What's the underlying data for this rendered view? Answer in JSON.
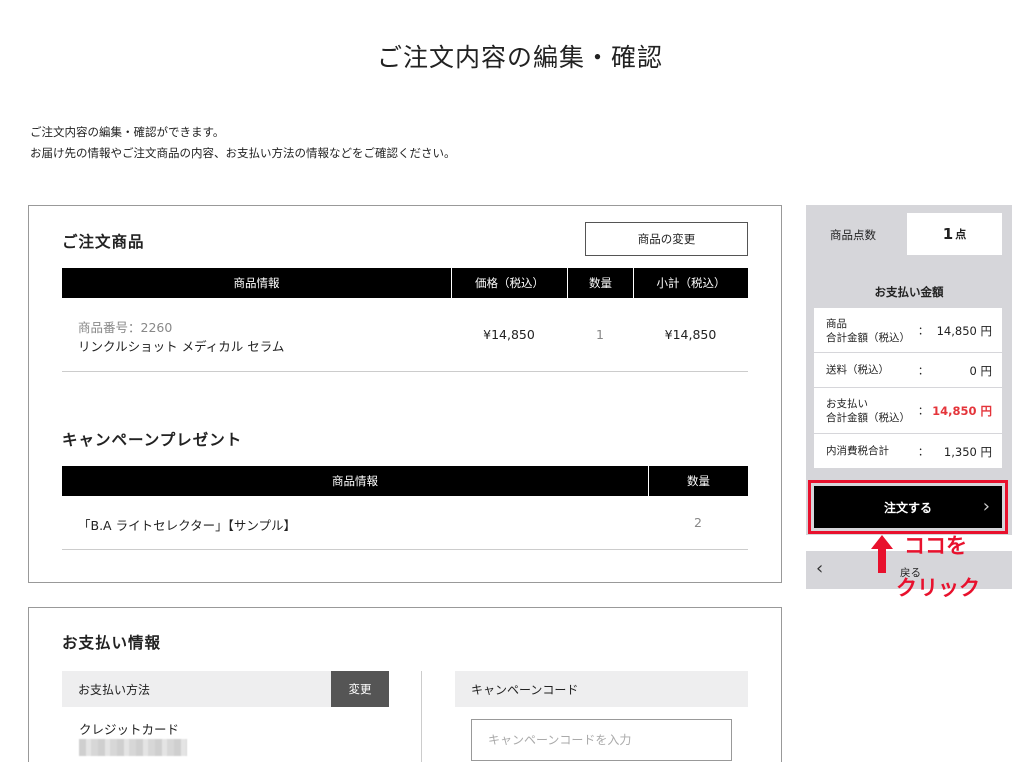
{
  "page_title": "ご注文内容の編集・確認",
  "intro": [
    "ご注文内容の編集・確認ができます。",
    "お届け先の情報やご注文商品の内容、お支払い方法の情報などをご確認ください。"
  ],
  "order": {
    "title": "ご注文商品",
    "change_button": "商品の変更",
    "columns": [
      "商品情報",
      "価格（税込）",
      "数量",
      "小計（税込）"
    ],
    "items": [
      {
        "product_number": "商品番号：2260",
        "name": "リンクルショット メディカル セラム",
        "price": "¥14,850",
        "qty": "1",
        "subtotal": "¥14,850"
      }
    ]
  },
  "campaign": {
    "title": "キャンペーンプレゼント",
    "columns": [
      "商品情報",
      "数量"
    ],
    "items": [
      {
        "name": "「B.A ライトセレクター」【サンプル】",
        "qty": "2"
      }
    ]
  },
  "summary": {
    "count_label": "商品点数",
    "count_value": "1",
    "count_unit": "点",
    "payment_heading": "お支払い金額",
    "rows": [
      {
        "label1": "商品",
        "label2": "合計金額（税込）",
        "colon": "：",
        "value": "14,850 円"
      },
      {
        "label1": "送料（税込）",
        "label2": "",
        "colon": "：",
        "value": "0 円"
      },
      {
        "label1": "お支払い",
        "label2": "合計金額（税込）",
        "colon": "：",
        "value": "14,850 円"
      },
      {
        "label1": "内消費税合計",
        "label2": "",
        "colon": "：",
        "value": "1,350 円"
      }
    ],
    "order_button": "注文する",
    "order_chevron": "›",
    "back_chevron": "‹",
    "back_label": "戻る",
    "accent_color": "#e4343a"
  },
  "annotation": {
    "line1": "ココを",
    "line2": "クリック",
    "color": "#e8112d"
  },
  "payment": {
    "title": "お支払い情報",
    "method_label": "お支払い方法",
    "change_button": "変更",
    "method_value": "クレジットカード",
    "campaign_code_label": "キャンペーンコード",
    "campaign_code_placeholder": "キャンペーンコードを入力"
  }
}
